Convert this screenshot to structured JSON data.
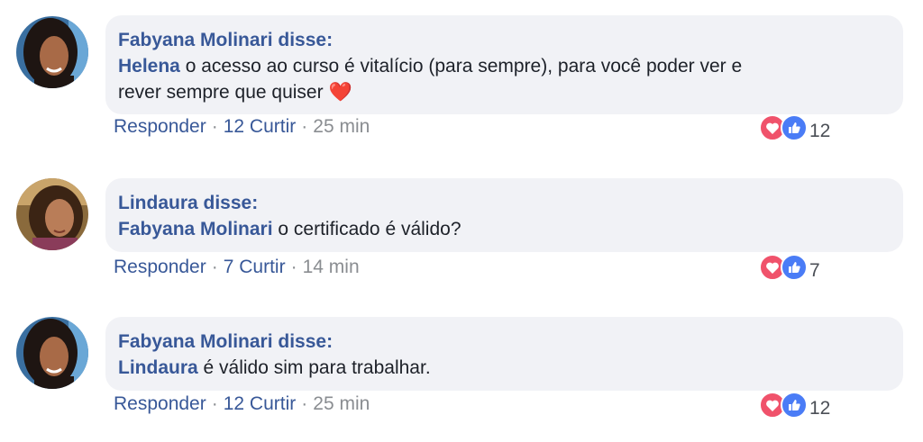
{
  "comments": [
    {
      "author": "Fabyana Molinari disse:",
      "lines": [
        {
          "mention": "Helena",
          "text": " o acesso ao curso é vitalício (para sempre), para você poder ver e"
        },
        {
          "mention": "",
          "text": "rever sempre que quiser ❤️"
        }
      ],
      "reply_label": "Responder",
      "likes_label": "12 Curtir",
      "time": "25 min",
      "reaction_count": "12",
      "avatar": "woman-dark-hair-avatar"
    },
    {
      "author": "Lindaura disse:",
      "lines": [
        {
          "mention": "Fabyana Molinari",
          "text": " o certificado é válido?"
        }
      ],
      "reply_label": "Responder",
      "likes_label": "7 Curtir",
      "time": "14 min",
      "reaction_count": "7",
      "avatar": "woman-brown-hair-avatar"
    },
    {
      "author": "Fabyana Molinari disse:",
      "lines": [
        {
          "mention": "Lindaura",
          "text": " é válido sim para trabalhar."
        }
      ],
      "reply_label": "Responder",
      "likes_label": "12 Curtir",
      "time": "25 min",
      "reaction_count": "12",
      "avatar": "woman-dark-hair-avatar"
    }
  ],
  "separator": "·",
  "colors": {
    "link": "#385898",
    "muted": "#8a8d91",
    "bubble": "#f1f2f6",
    "heart": "#f0526b",
    "like": "#4a7cf6"
  }
}
